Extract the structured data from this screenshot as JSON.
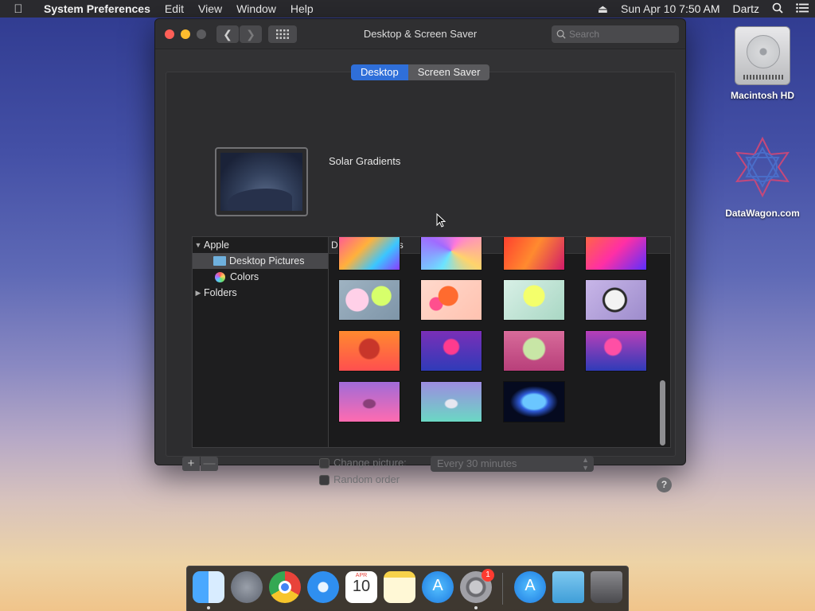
{
  "menubar": {
    "app_name": "System Preferences",
    "items": [
      "Edit",
      "View",
      "Window",
      "Help"
    ],
    "clock": "Sun Apr 10  7:50 AM",
    "user": "Dartz"
  },
  "desktop_icons": [
    {
      "label": "Macintosh HD",
      "icon": "hard-drive-icon"
    },
    {
      "label": "DataWagon.com",
      "icon": "datawagon-logo-icon"
    }
  ],
  "window": {
    "title": "Desktop & Screen Saver",
    "search_placeholder": "Search",
    "tabs": [
      {
        "label": "Desktop",
        "selected": true
      },
      {
        "label": "Screen Saver",
        "selected": false
      }
    ],
    "current_picture_name": "Solar Gradients",
    "sources": {
      "group_apple": "Apple",
      "desktop_pictures": "Desktop Pictures",
      "colors": "Colors",
      "folders": "Folders"
    },
    "grid_header": "Desktop Pictures",
    "change_picture_label": "Change picture:",
    "change_picture_interval": "Every 30 minutes",
    "random_order_label": "Random order",
    "add_label": "+",
    "remove_label": "—",
    "help_label": "?"
  },
  "dock": {
    "apps": [
      "Finder",
      "Launchpad",
      "Chrome",
      "Safari",
      "Calendar",
      "Notes",
      "App Store",
      "System Preferences",
      "App Store",
      "Downloads",
      "Trash"
    ],
    "calendar_month": "APR",
    "calendar_day": "10",
    "system_prefs_badge": "1"
  },
  "colors": {
    "accent": "#2f6fd9",
    "close": "#ff5f57",
    "minimize": "#febc2e"
  }
}
